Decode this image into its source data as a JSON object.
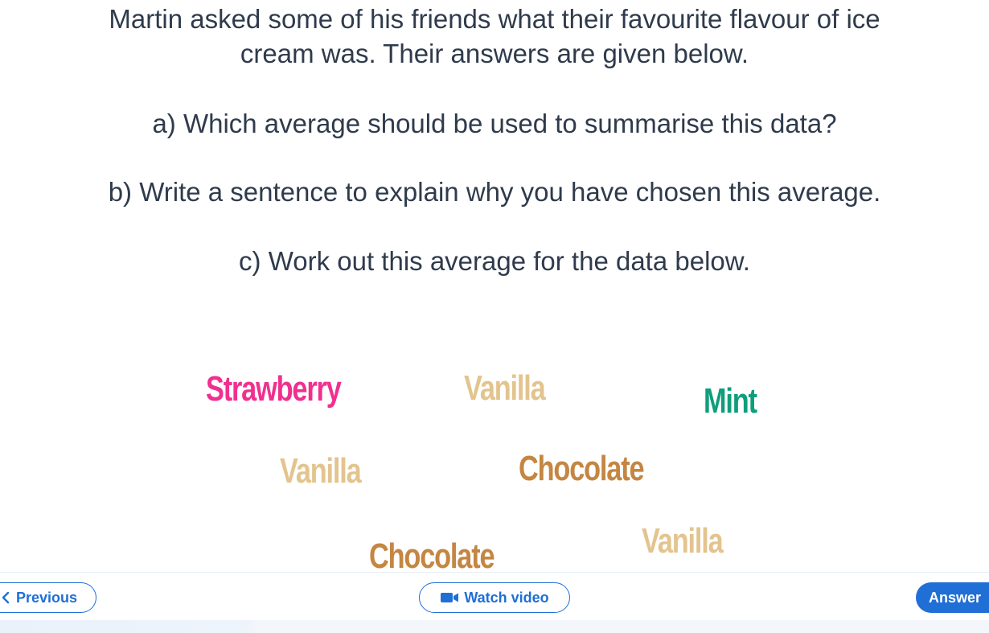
{
  "question": {
    "line1": "Martin asked some of his friends what their favourite flavour of ice",
    "line2": "cream was. Their answers are given below.",
    "part_a": "a) Which average should be used to summarise this data?",
    "part_b": "b) Write a sentence to explain why you have chosen this average.",
    "part_c": "c) Work out this average for the data below."
  },
  "flavours": [
    {
      "label": "Strawberry",
      "color": "#f0308f"
    },
    {
      "label": "Vanilla",
      "color": "#e3c48e"
    },
    {
      "label": "Mint",
      "color": "#0f9e7c"
    },
    {
      "label": "Vanilla",
      "color": "#e3c48e"
    },
    {
      "label": "Chocolate",
      "color": "#c48642"
    },
    {
      "label": "Chocolate",
      "color": "#c48642"
    },
    {
      "label": "Vanilla",
      "color": "#e3c48e"
    }
  ],
  "toolbar": {
    "previous_label": "Previous",
    "watch_video_label": "Watch video",
    "answer_label": "Answer"
  },
  "colors": {
    "accent": "#1f6fd6",
    "text": "#2f3b4c"
  },
  "icons": {
    "previous": "chevron-left-icon",
    "video": "video-camera-icon"
  }
}
